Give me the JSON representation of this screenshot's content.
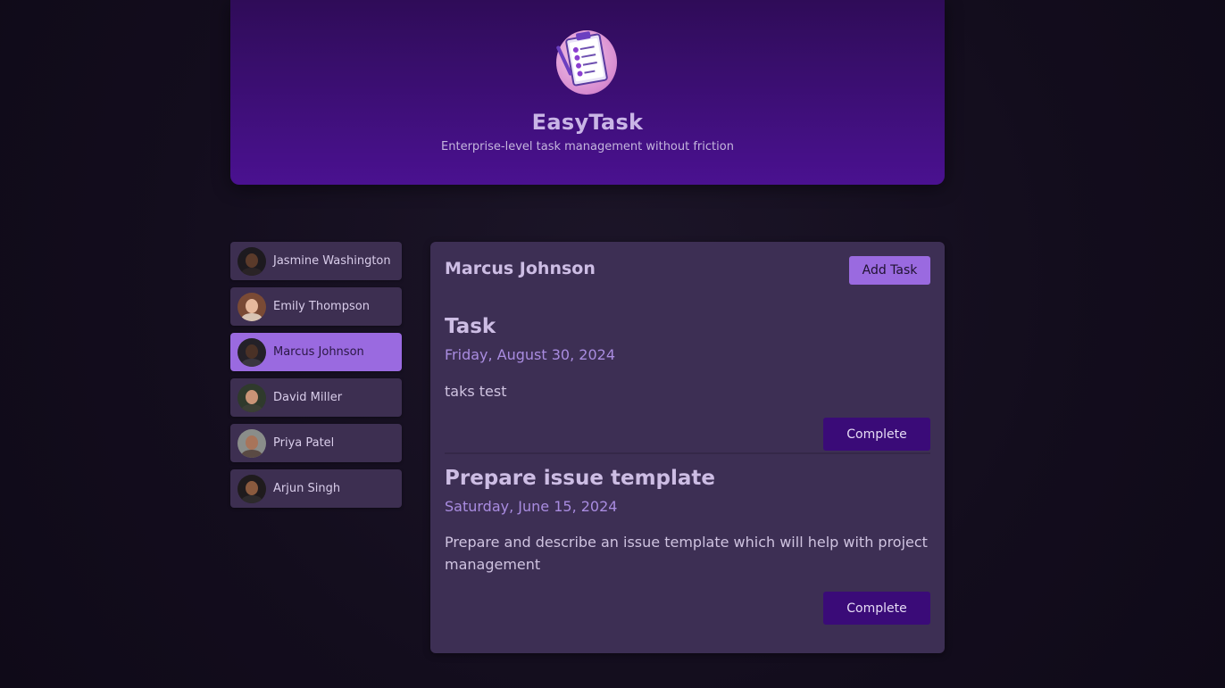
{
  "app": {
    "title": "EasyTask",
    "subtitle": "Enterprise-level task management without friction"
  },
  "users": [
    {
      "name": "Jasmine Washington",
      "active": false
    },
    {
      "name": "Emily Thompson",
      "active": false
    },
    {
      "name": "Marcus Johnson",
      "active": true
    },
    {
      "name": "David Miller",
      "active": false
    },
    {
      "name": "Priya Patel",
      "active": false
    },
    {
      "name": "Arjun Singh",
      "active": false
    }
  ],
  "panel": {
    "selected_user": "Marcus Johnson",
    "add_task_label": "Add Task",
    "tasks": [
      {
        "title": "Task",
        "date": "Friday, August 30, 2024",
        "description": "taks test",
        "complete_label": "Complete"
      },
      {
        "title": "Prepare issue template",
        "date": "Saturday, June 15, 2024",
        "description": "Prepare and describe an issue template which will help with project management",
        "complete_label": "Complete"
      }
    ]
  },
  "colors": {
    "accent": "#9a6ae0",
    "header": "#3f0f7a",
    "complete_button": "#3a0b78",
    "panel": "#3d2f54"
  }
}
